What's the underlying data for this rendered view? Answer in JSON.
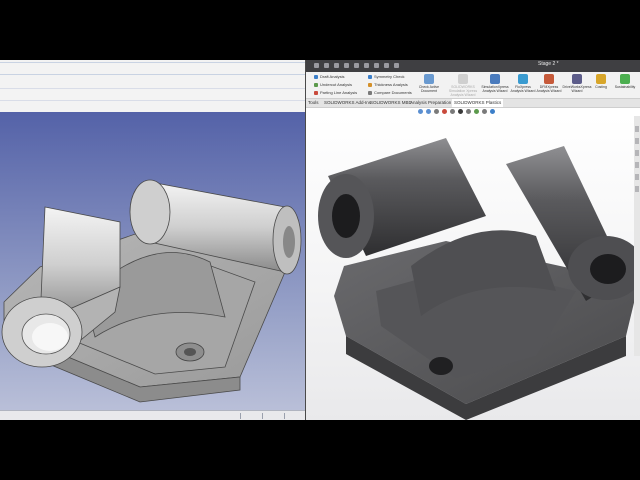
{
  "left_app": {
    "background_top": "#5462a8",
    "background_bottom": "#b9bfd8"
  },
  "right_app": {
    "window_title": "Stage 2 *",
    "ribbon": {
      "small_buttons": [
        {
          "label": "Draft Analysis",
          "icon": "draft-analysis-icon"
        },
        {
          "label": "Undercut Analysis",
          "icon": "undercut-analysis-icon"
        },
        {
          "label": "Parting Line Analysis",
          "icon": "parting-line-icon"
        },
        {
          "label": "Symmetry Check",
          "icon": "symmetry-check-icon"
        },
        {
          "label": "Thickness Analysis",
          "icon": "thickness-analysis-icon"
        },
        {
          "label": "Compare Documents",
          "icon": "compare-documents-icon"
        }
      ],
      "big_buttons": [
        {
          "label": "Check Active Document",
          "icon": "check-document-icon"
        },
        {
          "label": "SOLIDWORKS Simulation Xpress Analysis Wizard",
          "icon": "simulation-icon",
          "disabled": true
        },
        {
          "label": "SimulationXpress Analysis Wizard",
          "icon": "simulationxpress-icon"
        },
        {
          "label": "FloXpress Analysis Wizard",
          "icon": "floxpress-icon"
        },
        {
          "label": "DFMXpress Analysis Wizard",
          "icon": "dfmxpress-icon"
        },
        {
          "label": "DriveWorksXpress Wizard",
          "icon": "driveworks-icon"
        },
        {
          "label": "Costing",
          "icon": "costing-icon"
        },
        {
          "label": "Sustainability",
          "icon": "sustainability-icon"
        }
      ]
    },
    "tabs": [
      {
        "label": "Tools"
      },
      {
        "label": "SOLIDWORKS Add-Ins"
      },
      {
        "label": "SOLIDWORKS MBD"
      },
      {
        "label": "Analysis Preparation"
      },
      {
        "label": "SOLIDWORKS Plastics",
        "active": true
      }
    ],
    "colors": {
      "title_bar": "#3f3f42",
      "part": "#3a3a3c"
    }
  }
}
